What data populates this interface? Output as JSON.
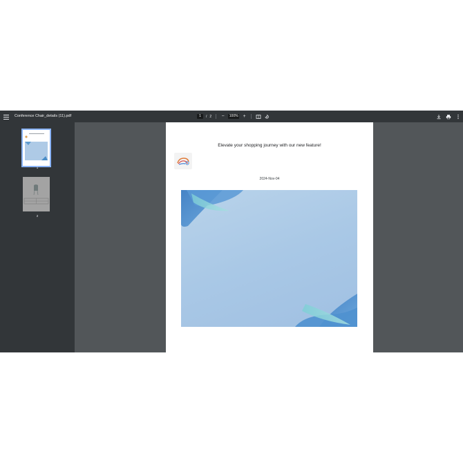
{
  "toolbar": {
    "title": "Conference Chair_details (11).pdf",
    "current_page": "1",
    "page_separator": "/",
    "total_pages": "2",
    "zoom": "100%"
  },
  "thumbnails": [
    {
      "label": "1"
    },
    {
      "label": "2"
    }
  ],
  "page": {
    "headline": "Elevate your shopping journey with our new feature!",
    "date": "2024-Nov-04"
  },
  "colors": {
    "toolbar_bg": "#323639",
    "viewer_bg": "#525659",
    "thumb_selected_border": "#8ab4f8"
  }
}
